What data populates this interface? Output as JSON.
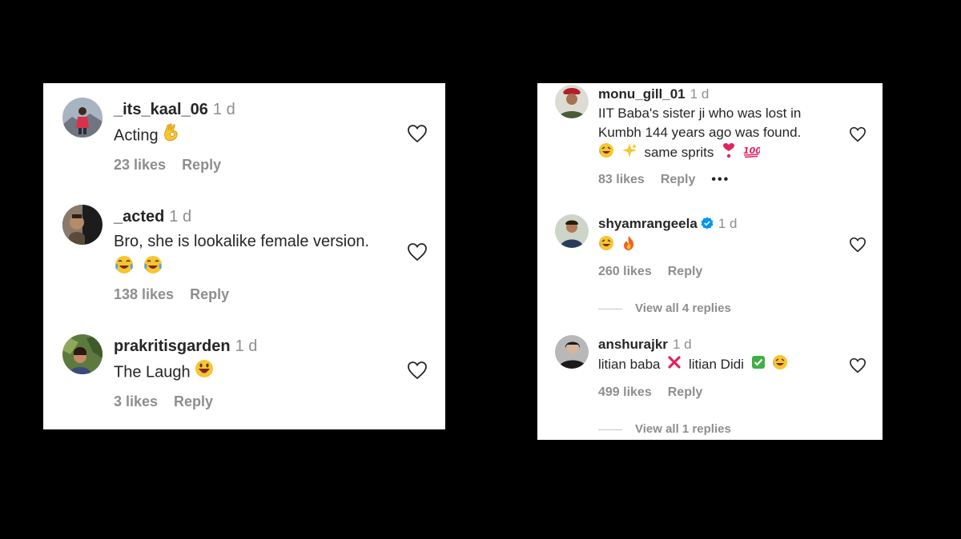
{
  "left_panel": {
    "comments": [
      {
        "username": "_its_kaal_06",
        "time": "1 d",
        "text": "Acting",
        "likes": "23 likes",
        "reply": "Reply"
      },
      {
        "username": "_acted",
        "time": "1 d",
        "text": "Bro, she is lookalike female version.",
        "likes": "138 likes",
        "reply": "Reply"
      },
      {
        "username": "prakritisgarden",
        "time": "1 d",
        "text": "The Laugh",
        "likes": "3 likes",
        "reply": "Reply"
      }
    ]
  },
  "right_panel": {
    "comments": [
      {
        "username": "monu_gill_01",
        "time": "1 d",
        "text_line1": "IIT Baba's sister ji who was lost in",
        "text_line2": "Kumbh 144 years ago was found.",
        "text_line3": "same sprits",
        "likes": "83 likes",
        "reply": "Reply",
        "more": "•••"
      },
      {
        "username": "shyamrangeela",
        "time": "1 d",
        "verified": true,
        "likes": "260 likes",
        "reply": "Reply",
        "view_replies": "View all 4 replies"
      },
      {
        "username": "anshurajkr",
        "time": "1 d",
        "text_a": "litian baba",
        "text_b": "litian Didi",
        "likes": "499 likes",
        "reply": "Reply",
        "view_replies": "View all 1 replies"
      }
    ]
  },
  "colors": {
    "background": "#000000",
    "panel": "#ffffff",
    "username": "#262626",
    "secondary": "#8e8e8e",
    "verified": "#0095f6"
  }
}
